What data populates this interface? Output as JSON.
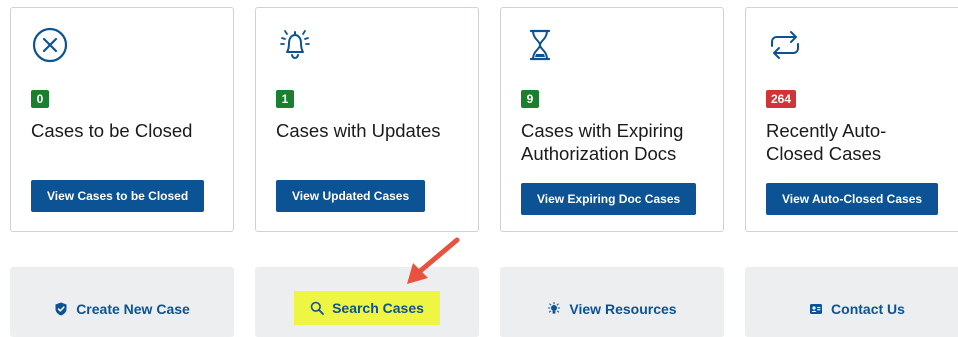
{
  "cards": [
    {
      "badge": "0",
      "title": "Cases to be Closed",
      "button": "View Cases to be Closed",
      "icon": "close-circle-icon"
    },
    {
      "badge": "1",
      "title": "Cases with Updates",
      "button": "View Updated Cases",
      "icon": "bell-ringing-icon"
    },
    {
      "badge": "9",
      "title": "Cases with Expiring Authorization Docs",
      "button": "View Expiring Doc Cases",
      "icon": "hourglass-icon"
    },
    {
      "badge": "264",
      "title": "Recently Auto-Closed Cases",
      "button": "View Auto-Closed Cases",
      "icon": "repeat-icon"
    }
  ],
  "tiles": [
    {
      "label": "Create New Case",
      "icon": "shield-check-icon"
    },
    {
      "label": "Search Cases",
      "icon": "search-icon"
    },
    {
      "label": "View Resources",
      "icon": "lightbulb-icon"
    },
    {
      "label": "Contact Us",
      "icon": "contact-card-icon"
    }
  ],
  "colors": {
    "accent": "#0b5394",
    "badge_green": "#1a7f2e",
    "badge_red": "#d13438",
    "highlight": "#eef542",
    "annotation_arrow": "#e8523f"
  }
}
